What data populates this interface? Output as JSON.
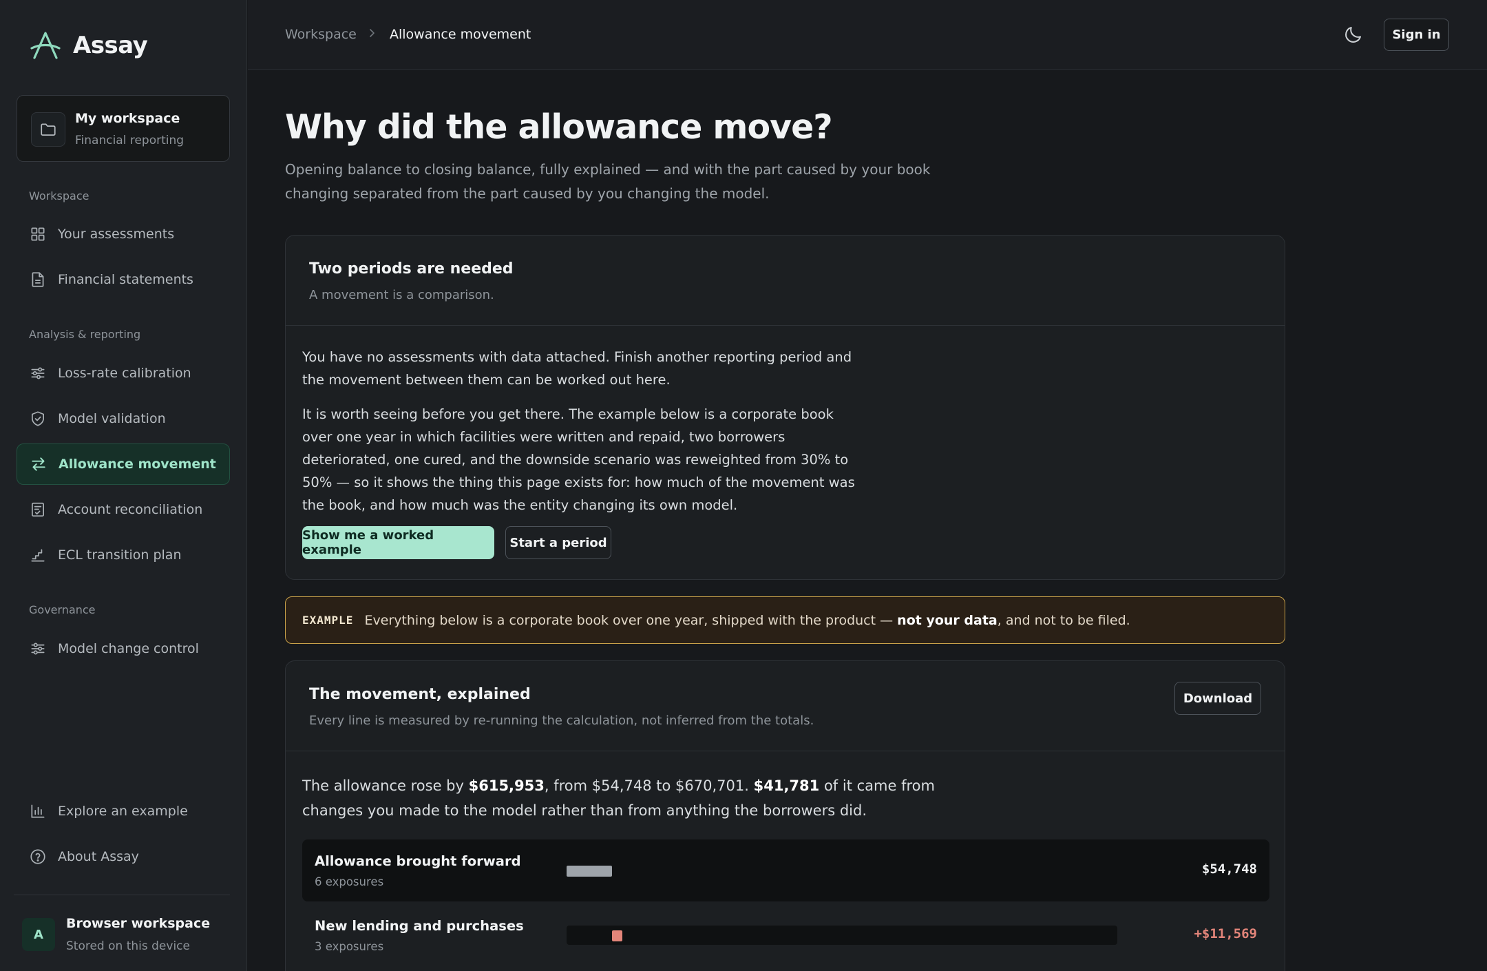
{
  "app": {
    "name": "Assay"
  },
  "workspace_card": {
    "title": "My workspace",
    "subtitle": "Financial reporting"
  },
  "sidebar": {
    "sections": [
      {
        "label": "Workspace"
      },
      {
        "label": "Analysis & reporting"
      },
      {
        "label": "Governance"
      }
    ],
    "items": [
      {
        "label": "Your assessments",
        "icon": "grid-icon"
      },
      {
        "label": "Financial statements",
        "icon": "document-icon"
      },
      {
        "label": "Loss-rate calibration",
        "icon": "sliders-icon"
      },
      {
        "label": "Model validation",
        "icon": "shield-check-icon"
      },
      {
        "label": "Allowance movement",
        "icon": "arrows-swap-icon",
        "active": true
      },
      {
        "label": "Account reconciliation",
        "icon": "checklist-icon"
      },
      {
        "label": "ECL transition plan",
        "icon": "stairs-icon"
      },
      {
        "label": "Model change control",
        "icon": "sliders-icon"
      }
    ],
    "footer_items": [
      {
        "label": "Explore an example",
        "icon": "bar-chart-icon"
      },
      {
        "label": "About Assay",
        "icon": "help-circle-icon"
      }
    ],
    "user": {
      "avatar": "A",
      "name": "Browser workspace",
      "subtitle": "Stored on this device"
    }
  },
  "header": {
    "breadcrumb": [
      "Workspace",
      "Allowance movement"
    ],
    "theme_icon": "moon-icon",
    "signin_label": "Sign in"
  },
  "page": {
    "title": "Why did the allowance move?",
    "subtitle": "Opening balance to closing balance, fully explained — and with the part caused by your book changing separated from the part caused by you changing the model."
  },
  "periods_card": {
    "title": "Two periods are needed",
    "subtitle": "A movement is a comparison.",
    "para1": "You have no assessments with data attached. Finish another reporting period and the movement between them can be worked out here.",
    "para2": "It is worth seeing before you get there. The example below is a corporate book over one year in which facilities were written and repaid, two borrowers deteriorated, one cured, and the downside scenario was reweighted from 30% to 50% — so it shows the thing this page exists for: how much of the movement was the book, and how much was the entity changing its own model.",
    "primary_label": "Show me a worked example",
    "secondary_label": "Start a period"
  },
  "banner": {
    "tag": "EXAMPLE",
    "text_before": "Everything below is a corporate book over one year, shipped with the product —",
    "text_bold": "not your data",
    "text_after": ", and not to be filed."
  },
  "movement_card": {
    "title": "The movement, explained",
    "subtitle": "Every line is measured by re-running the calculation, not inferred from the totals.",
    "download_label": "Download",
    "summary": {
      "t1": "The allowance rose by ",
      "b1": "$615,953",
      "t2": ", from $54,748 to $670,701. ",
      "b2": "$41,781",
      "t3": " of it came from changes you made to the model rather than from anything the borrowers did."
    },
    "rows": [
      {
        "label": "Allowance brought forward",
        "sub": "6 exposures",
        "value": "$54,748",
        "bar_color": "#9ea4aa",
        "value_color": "#f1f3f4"
      },
      {
        "label": "New lending and purchases",
        "sub": "3 exposures",
        "value": "+$11,569",
        "bar_color": "#e3857a",
        "value_color": "#e3857a"
      }
    ]
  }
}
